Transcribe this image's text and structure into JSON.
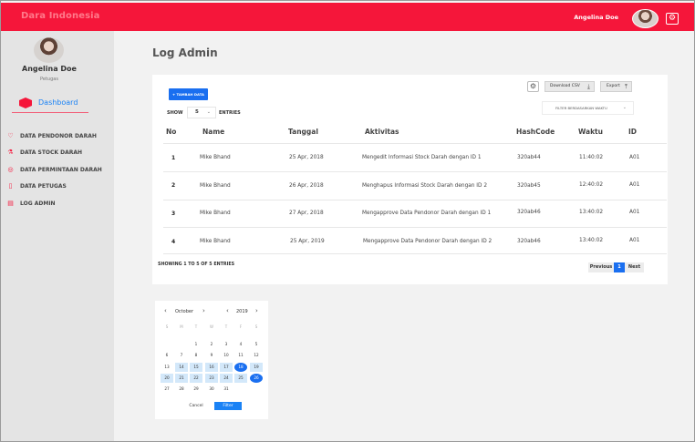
{
  "app": {
    "brand": "Dara Indonesia",
    "user": "Angelina Doe",
    "accent": "#f5163a",
    "primary": "#1a6ff0"
  },
  "sidebar": {
    "name": "Angelina Doe",
    "role": "Petugas",
    "dashboard": "Dashboard",
    "items": [
      {
        "label": "DATA PENDONOR DARAH",
        "icon": "hand-heart-icon"
      },
      {
        "label": "DATA STOCK DARAH",
        "icon": "flask-icon"
      },
      {
        "label": "DATA PERMINTAAN DARAH",
        "icon": "request-icon"
      },
      {
        "label": "DATA PETUGAS",
        "icon": "document-icon"
      },
      {
        "label": "LOG ADMIN",
        "icon": "log-icon"
      }
    ]
  },
  "main": {
    "title": "Log Admin",
    "add_button": "+ TAMBAH DATA",
    "show_label": "SHOW",
    "entries_value": "5",
    "entries_label": "ENTRIES",
    "download_csv": "Download CSV",
    "export": "Export",
    "filter_placeholder": "FILTER BERDASARKAN WAKTU",
    "columns": [
      "No",
      "Name",
      "Tanggal",
      "Aktivitas",
      "HashCode",
      "Waktu",
      "ID"
    ],
    "rows": [
      [
        "1",
        "Mike Bhand",
        "25 Apr, 2018",
        "Mengedit Informasi Stock Darah dengan ID 1",
        "320ab44",
        "11:40:02",
        "A01"
      ],
      [
        "2",
        "Mike Bhand",
        "26 Apr, 2018",
        "Menghapus Informasi Stock Darah dengan ID 2",
        "320ab45",
        "12:40:02",
        "A01"
      ],
      [
        "3",
        "Mike Bhand",
        "27 Apr, 2018",
        "Mengapprove Data Pendonor Darah dengan ID 1",
        "320ab46",
        "13:40:02",
        "A01"
      ],
      [
        "4",
        "Mike Bhand",
        "25 Apr, 2019",
        "Mengapprove Data Pendonor Darah dengan ID 2",
        "320ab46",
        "13:40:02",
        "A01"
      ]
    ],
    "showing": "SHOWING 1 TO 5 OF 5 ENTRIES",
    "pager": {
      "prev": "Previous",
      "current": "1",
      "next": "Next"
    }
  },
  "calendar": {
    "month": "October",
    "year": "2019",
    "weekdays": [
      "S",
      "M",
      "T",
      "W",
      "T",
      "F",
      "S"
    ],
    "first_weekday_index": 2,
    "days_in_month": 31,
    "range_days": [
      14,
      15,
      16,
      17,
      18,
      19,
      20,
      21,
      22,
      23,
      24,
      25,
      26
    ],
    "selected_days": [
      18,
      26
    ],
    "cancel": "Cancel",
    "filter": "Filter"
  }
}
